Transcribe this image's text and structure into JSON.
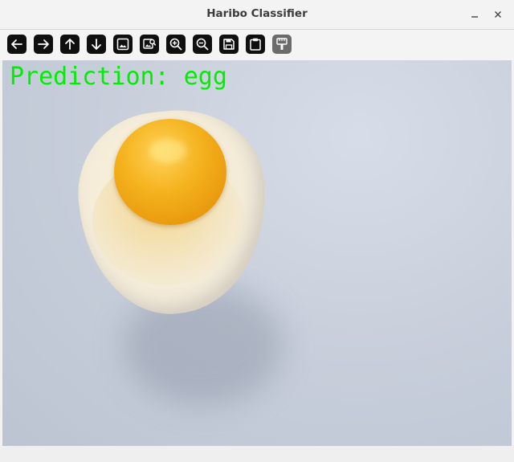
{
  "window": {
    "title": "Haribo Classifier"
  },
  "toolbar": {
    "tools": [
      {
        "name": "back",
        "icon": "arrow-left-icon"
      },
      {
        "name": "forward",
        "icon": "arrow-right-icon"
      },
      {
        "name": "up",
        "icon": "arrow-up-icon"
      },
      {
        "name": "down",
        "icon": "arrow-down-icon"
      },
      {
        "name": "fit-image",
        "icon": "image-icon"
      },
      {
        "name": "image-info",
        "icon": "image-search-icon"
      },
      {
        "name": "zoom-in",
        "icon": "zoom-in-icon"
      },
      {
        "name": "zoom-out",
        "icon": "zoom-out-icon"
      },
      {
        "name": "save",
        "icon": "save-icon"
      },
      {
        "name": "copy",
        "icon": "clipboard-icon"
      },
      {
        "name": "properties",
        "icon": "paint-brush-icon",
        "disabled": true
      }
    ]
  },
  "image": {
    "overlay_text": "Prediction: egg",
    "overlay_color": "#00ee00"
  }
}
